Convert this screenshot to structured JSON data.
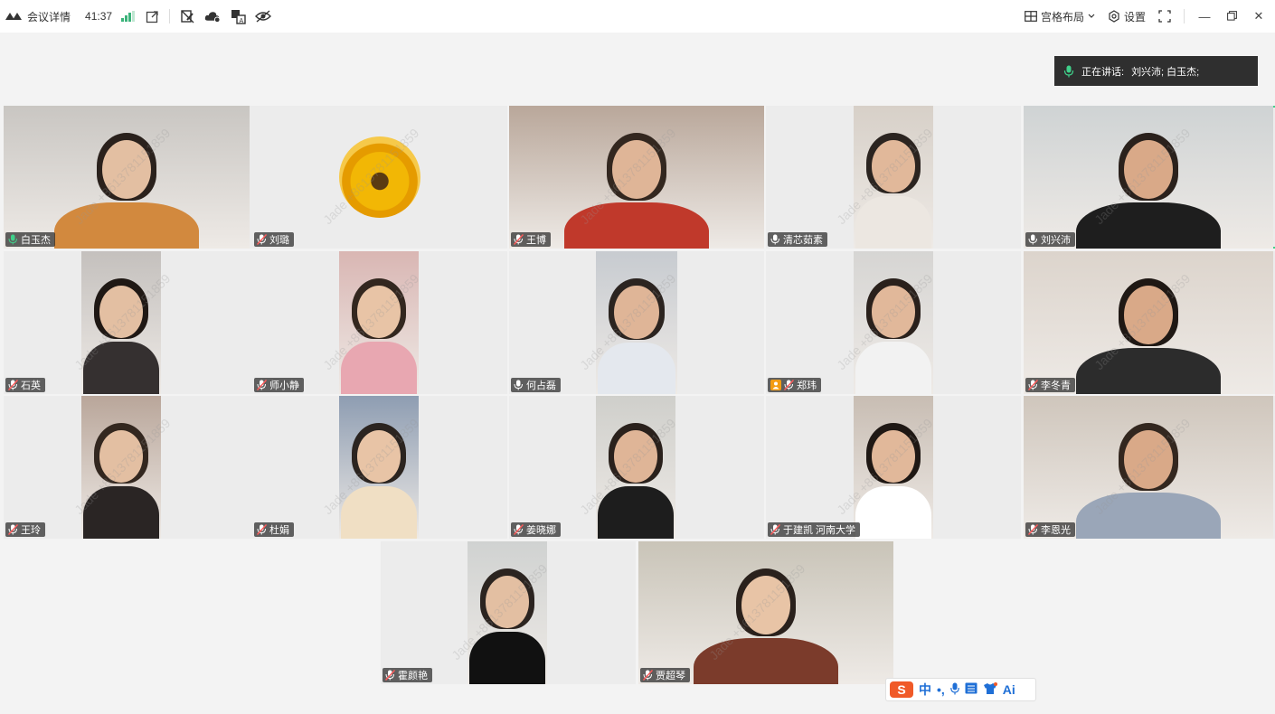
{
  "titlebar": {
    "meeting_details": "会议详情",
    "timer": "41:37",
    "layout_label": "宫格布局",
    "settings_label": "设置"
  },
  "speaker_bar": {
    "prefix": "正在讲话:",
    "names": "刘兴沛; 白玉杰;"
  },
  "watermark_text": "Jade +8613781151859",
  "participants": [
    {
      "name": "白玉杰",
      "mic": "active"
    },
    {
      "name": "刘璐",
      "mic": "muted"
    },
    {
      "name": "王博",
      "mic": "muted"
    },
    {
      "name": "清芯茹素",
      "mic": "on"
    },
    {
      "name": "刘兴沛",
      "mic": "on"
    },
    {
      "name": "石英",
      "mic": "muted"
    },
    {
      "name": "师小静",
      "mic": "muted"
    },
    {
      "name": "何占磊",
      "mic": "on"
    },
    {
      "name": "郑玮",
      "mic": "muted"
    },
    {
      "name": "李冬青",
      "mic": "muted"
    },
    {
      "name": "王玲",
      "mic": "muted"
    },
    {
      "name": "杜娟",
      "mic": "muted"
    },
    {
      "name": "姜晓娜",
      "mic": "muted"
    },
    {
      "name": "于建凯 河南大学",
      "mic": "muted"
    },
    {
      "name": "李恩光",
      "mic": "muted"
    },
    {
      "name": "霍颜艳",
      "mic": "muted"
    },
    {
      "name": "贾超琴",
      "mic": "muted"
    }
  ],
  "ime": {
    "mode": "中",
    "punct": "•,",
    "ai": "Ai"
  },
  "colors": {
    "active_border": "#3fd08a",
    "signal": "#3bb37a",
    "speaker_mic": "#3fd08a"
  }
}
